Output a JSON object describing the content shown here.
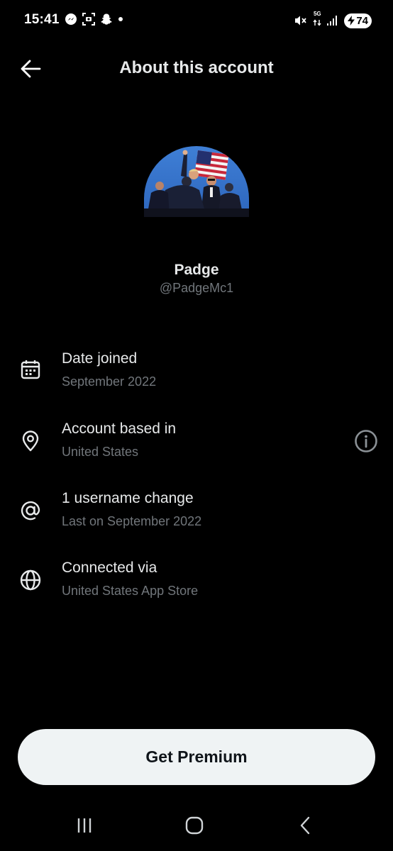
{
  "status_bar": {
    "time": "15:41",
    "network": "5G",
    "battery": "74"
  },
  "header": {
    "title": "About this account"
  },
  "profile": {
    "name": "Padge",
    "handle": "@PadgeMc1"
  },
  "info_rows": [
    {
      "icon": "calendar-icon",
      "title": "Date joined",
      "subtitle": "September 2022"
    },
    {
      "icon": "location-pin-icon",
      "title": "Account based in",
      "subtitle": "United States"
    },
    {
      "icon": "at-sign-icon",
      "title": "1 username change",
      "subtitle": "Last on September 2022"
    },
    {
      "icon": "globe-icon",
      "title": "Connected via",
      "subtitle": "United States App Store"
    }
  ],
  "cta": {
    "label": "Get Premium"
  },
  "colors": {
    "background": "#000000",
    "primary_text": "#e7e9ea",
    "secondary_text": "#71767b",
    "button_bg": "#eff3f4"
  }
}
